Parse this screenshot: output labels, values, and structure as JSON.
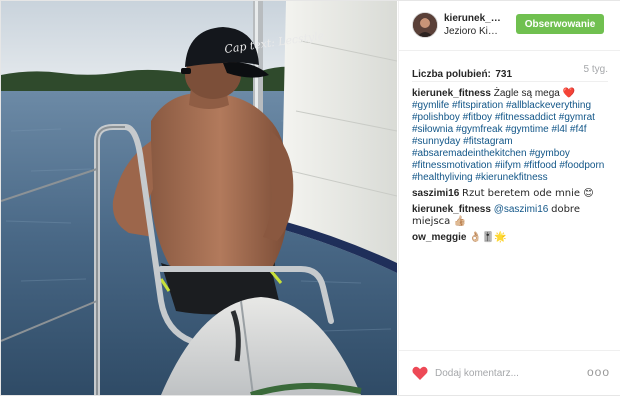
{
  "post": {
    "author": "kierunek_fitness",
    "location": "Jezioro Kisajno",
    "follow_label": "Obserwowanie",
    "likes_label": "Liczba polubień:",
    "likes_count": "731",
    "time_ago": "5 tyg.",
    "cap_text": "Cap text: Lecstyle"
  },
  "caption": {
    "user": "kierunek_fitness",
    "text": "Żagle są mega",
    "emoji": "❤️",
    "hashtags": [
      "#gymlife",
      "#fitspiration",
      "#allblackeverything",
      "#polishboy",
      "#fitboy",
      "#fitnessaddict",
      "#gymrat",
      "#siłownia",
      "#gymfreak",
      "#gymtime",
      "#l4l",
      "#f4f",
      "#sunnyday",
      "#fitstagram",
      "#absaremadeinthekitchen",
      "#gymboy",
      "#fitnessmotivation",
      "#iifym",
      "#fitfood",
      "#foodporn",
      "#healthyliving",
      "#kierunekfitness"
    ]
  },
  "comments": [
    {
      "user": "saszimi16",
      "text": "Rzut beretem ode mnie 😊"
    },
    {
      "user": "kierunek_fitness",
      "mention": "@saszimi16",
      "text": "dobre miejsca 👍🏼"
    },
    {
      "user": "ow_meggie",
      "text": "👌🏼🎚️🌟"
    }
  ],
  "footer": {
    "comment_placeholder": "Dodaj komentarz...",
    "more_label": "ooo"
  },
  "colors": {
    "follow_green": "#70c050",
    "link_blue": "#125688",
    "heart_red": "#ed4956",
    "muted_gray": "#a5a7aa"
  },
  "icons": [
    "heart-icon",
    "more-options-icon",
    "avatar"
  ]
}
